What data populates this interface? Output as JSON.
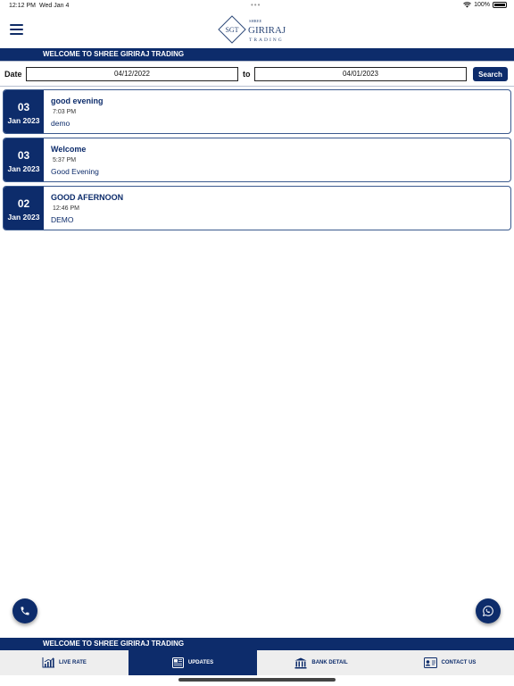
{
  "status_bar": {
    "time": "12:12 PM",
    "date": "Wed Jan 4",
    "battery": "100%"
  },
  "header": {
    "logo_mark": "SGT",
    "logo_top": "SHREE",
    "logo_name": "GIRIRAJ",
    "logo_sub": "TRADING"
  },
  "welcome_top": "WELCOME TO SHREE GIRIRAJ TRADING",
  "filter": {
    "date_label": "Date",
    "from_date": "04/12/2022",
    "to_label": "to",
    "to_date": "04/01/2023",
    "search_label": "Search"
  },
  "updates": [
    {
      "day": "03",
      "month_year": "Jan 2023",
      "title": "good evening",
      "time": "7:03 PM",
      "text": "demo"
    },
    {
      "day": "03",
      "month_year": "Jan 2023",
      "title": "Welcome",
      "time": "5:37 PM",
      "text": "Good Evening"
    },
    {
      "day": "02",
      "month_year": "Jan 2023",
      "title": "GOOD AFERNOON",
      "time": "12:46 PM",
      "text": "DEMO"
    }
  ],
  "welcome_bottom": "WELCOME TO SHREE GIRIRAJ TRADING",
  "nav": [
    {
      "label": "LIVE RATE",
      "icon": "chart-icon",
      "active": false
    },
    {
      "label": "UPDATES",
      "icon": "news-icon",
      "active": true
    },
    {
      "label": "BANK DETAIL",
      "icon": "bank-icon",
      "active": false
    },
    {
      "label": "CONTACT US",
      "icon": "contact-card-icon",
      "active": false
    }
  ],
  "colors": {
    "primary": "#0d2c6b",
    "nav_background": "#eeeeee"
  }
}
